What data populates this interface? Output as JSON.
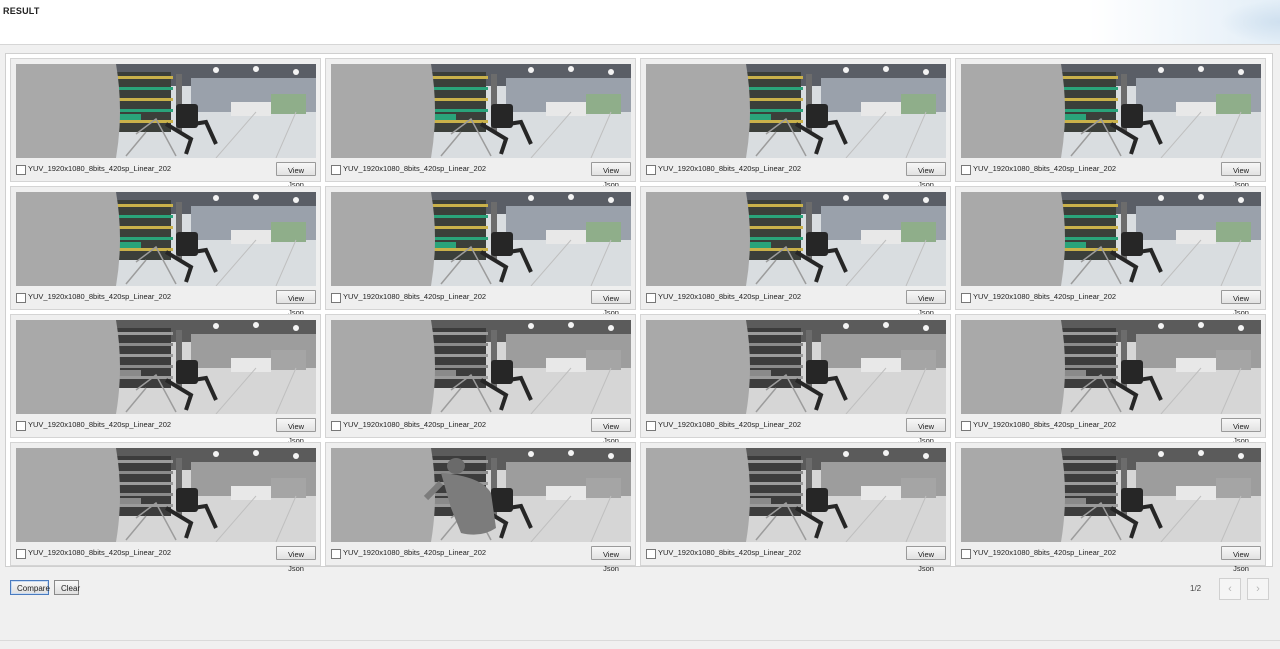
{
  "header": {
    "title": "RESULT"
  },
  "results": [
    {
      "label": "YUV_1920x1080_8bits_420sp_Linear_202",
      "button": "View Json",
      "tone": "color",
      "person": false
    },
    {
      "label": "YUV_1920x1080_8bits_420sp_Linear_202",
      "button": "View Json",
      "tone": "color",
      "person": false
    },
    {
      "label": "YUV_1920x1080_8bits_420sp_Linear_202",
      "button": "View Json",
      "tone": "color",
      "person": false
    },
    {
      "label": "YUV_1920x1080_8bits_420sp_Linear_202",
      "button": "View Json",
      "tone": "color",
      "person": false
    },
    {
      "label": "YUV_1920x1080_8bits_420sp_Linear_202",
      "button": "View Json",
      "tone": "color",
      "person": false
    },
    {
      "label": "YUV_1920x1080_8bits_420sp_Linear_202",
      "button": "View Json",
      "tone": "color",
      "person": false
    },
    {
      "label": "YUV_1920x1080_8bits_420sp_Linear_202",
      "button": "View Json",
      "tone": "color",
      "person": false
    },
    {
      "label": "YUV_1920x1080_8bits_420sp_Linear_202",
      "button": "View Json",
      "tone": "color",
      "person": false
    },
    {
      "label": "YUV_1920x1080_8bits_420sp_Linear_202",
      "button": "View Json",
      "tone": "gray",
      "person": false
    },
    {
      "label": "YUV_1920x1080_8bits_420sp_Linear_202",
      "button": "View Json",
      "tone": "gray",
      "person": false
    },
    {
      "label": "YUV_1920x1080_8bits_420sp_Linear_202",
      "button": "View Json",
      "tone": "gray",
      "person": false
    },
    {
      "label": "YUV_1920x1080_8bits_420sp_Linear_202",
      "button": "View Json",
      "tone": "gray",
      "person": false
    },
    {
      "label": "YUV_1920x1080_8bits_420sp_Linear_202",
      "button": "View Json",
      "tone": "gray",
      "person": false
    },
    {
      "label": "YUV_1920x1080_8bits_420sp_Linear_202",
      "button": "View Json",
      "tone": "gray",
      "person": true
    },
    {
      "label": "YUV_1920x1080_8bits_420sp_Linear_202",
      "button": "View Json",
      "tone": "gray",
      "person": false
    },
    {
      "label": "YUV_1920x1080_8bits_420sp_Linear_202",
      "button": "View Json",
      "tone": "gray",
      "person": false
    }
  ],
  "actions": {
    "compare": "Compare",
    "clear": "Clear"
  },
  "pagination": {
    "indicator": "1/2",
    "prev_icon": "chevron-left-icon",
    "next_icon": "chevron-right-icon"
  }
}
